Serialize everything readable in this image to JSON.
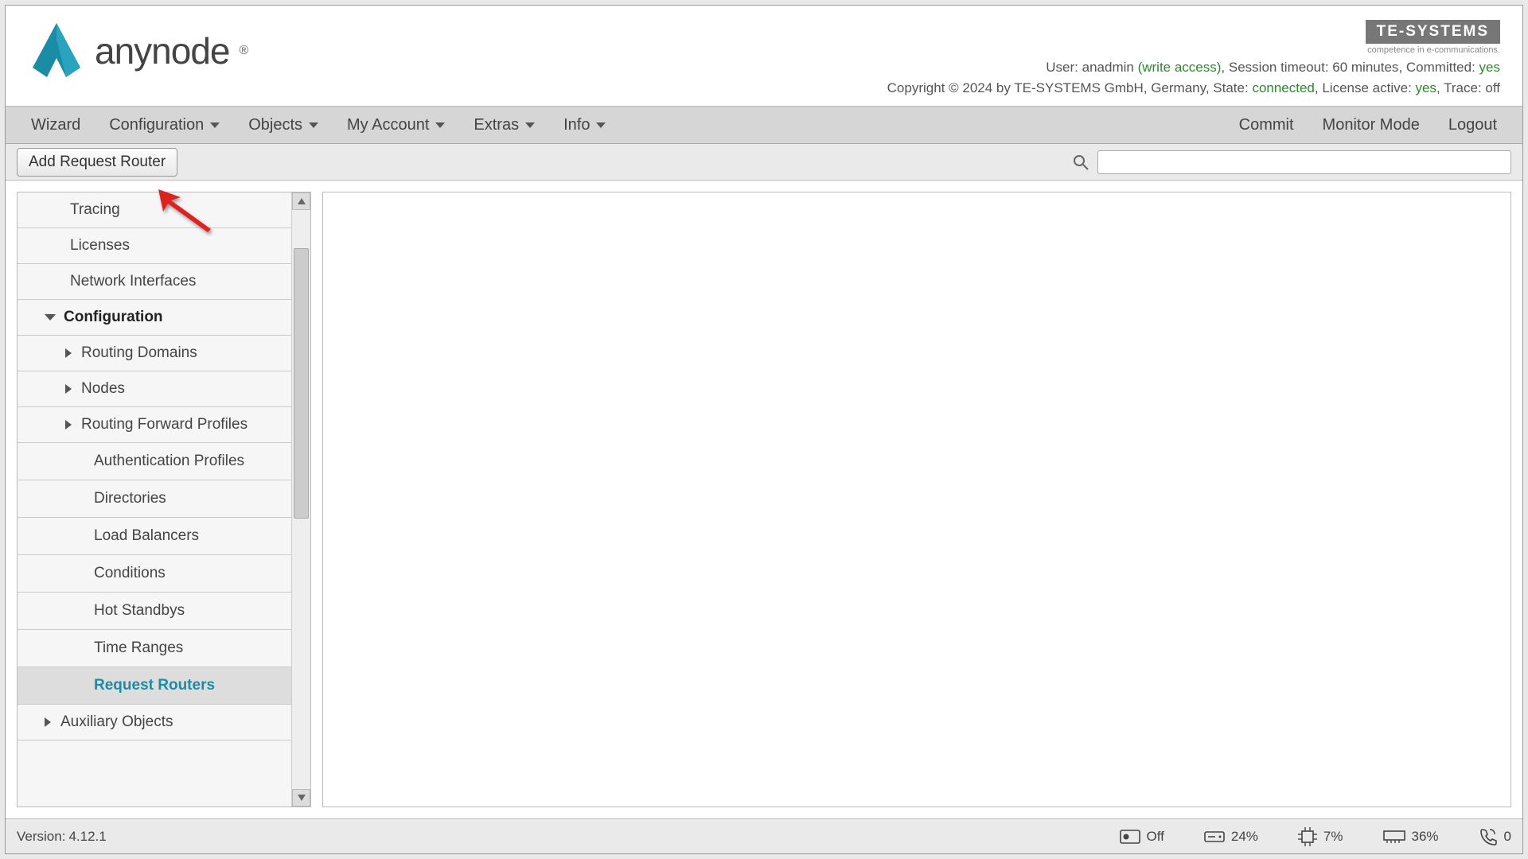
{
  "header": {
    "brand": "anynode",
    "company": "TE-SYSTEMS",
    "tagline": "competence in e-communications.",
    "user_prefix": "User: ",
    "user": "anadmin",
    "access": " (write access)",
    "session_label": ", Session timeout: ",
    "session_val": "60 minutes",
    "committed_label": ", Committed: ",
    "committed_val": "yes",
    "copyright": "Copyright © 2024 by TE-SYSTEMS GmbH, Germany, State: ",
    "state_val": "connected",
    "license_label": ", License active: ",
    "license_val": "yes",
    "trace_label": ", Trace: ",
    "trace_val": "off"
  },
  "menubar": {
    "wizard": "Wizard",
    "configuration": "Configuration",
    "objects": "Objects",
    "myaccount": "My Account",
    "extras": "Extras",
    "info": "Info",
    "commit": "Commit",
    "monitor": "Monitor Mode",
    "logout": "Logout"
  },
  "toolbar": {
    "add_router": "Add Request Router",
    "search_placeholder": ""
  },
  "sidebar": {
    "items": [
      {
        "label": "Tracing"
      },
      {
        "label": "Licenses"
      },
      {
        "label": "Network Interfaces"
      }
    ],
    "section": "Configuration",
    "config_items": [
      {
        "label": "Routing Domains",
        "expandable": true
      },
      {
        "label": "Nodes",
        "expandable": true
      },
      {
        "label": "Routing Forward Profiles",
        "expandable": true
      },
      {
        "label": "Authentication Profiles",
        "expandable": false
      },
      {
        "label": "Directories",
        "expandable": false
      },
      {
        "label": "Load Balancers",
        "expandable": false
      },
      {
        "label": "Conditions",
        "expandable": false
      },
      {
        "label": "Hot Standbys",
        "expandable": false
      },
      {
        "label": "Time Ranges",
        "expandable": false
      },
      {
        "label": "Request Routers",
        "expandable": false,
        "active": true
      }
    ],
    "aux": "Auxiliary Objects"
  },
  "footer": {
    "version_label": "Version: ",
    "version": "4.12.1",
    "rec": "Off",
    "disk": "24%",
    "cpu": "7%",
    "mem": "36%",
    "calls": "0"
  }
}
